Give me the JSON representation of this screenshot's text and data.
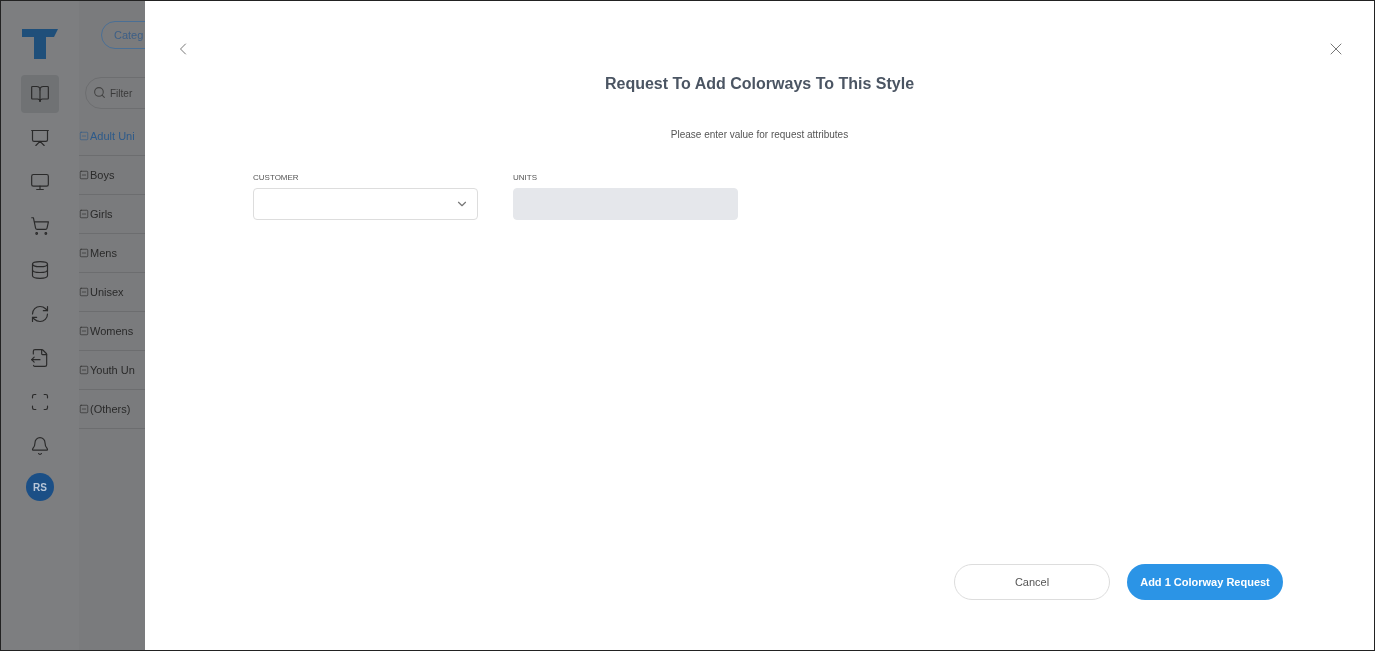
{
  "nav": {
    "items": [
      {
        "selected": true
      },
      {
        "selected": false
      },
      {
        "selected": false
      },
      {
        "selected": false
      },
      {
        "selected": false
      },
      {
        "selected": false
      },
      {
        "selected": false
      },
      {
        "selected": false
      },
      {
        "selected": false
      }
    ],
    "avatar": "RS"
  },
  "categories": {
    "button": "Categ",
    "filter_placeholder": "Filter",
    "items": [
      {
        "label": "Adult Uni",
        "selected": true
      },
      {
        "label": "Boys",
        "selected": false
      },
      {
        "label": "Girls",
        "selected": false
      },
      {
        "label": "Mens",
        "selected": false
      },
      {
        "label": "Unisex",
        "selected": false
      },
      {
        "label": "Womens",
        "selected": false
      },
      {
        "label": "Youth Un",
        "selected": false
      },
      {
        "label": "(Others)",
        "selected": false
      }
    ]
  },
  "dialog": {
    "title": "Request To Add Colorways To This Style",
    "subtitle": "Please enter value for request attributes",
    "fields": [
      {
        "label": "CUSTOMER",
        "kind": "select",
        "disabled": false
      },
      {
        "label": "UNITS",
        "kind": "text",
        "disabled": true
      }
    ],
    "buttons": [
      {
        "label": "Cancel",
        "kind": "secondary"
      },
      {
        "label": "Add 1 Colorway Request",
        "kind": "primary"
      }
    ]
  }
}
